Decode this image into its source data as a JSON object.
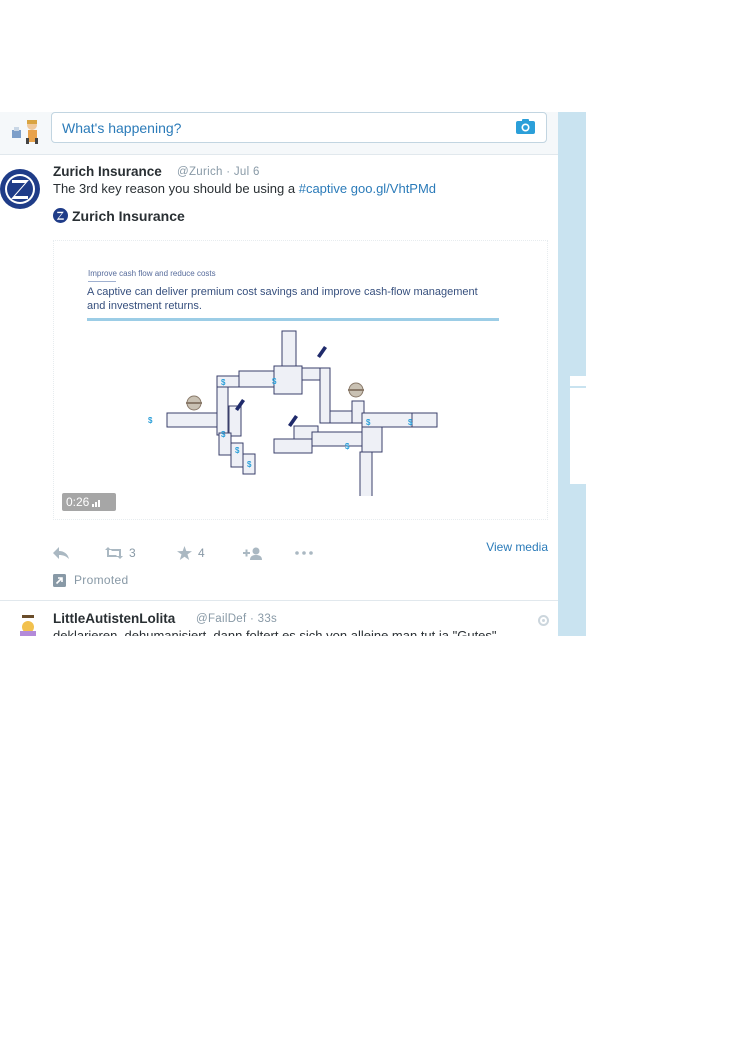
{
  "compose": {
    "placeholder": "What's happening?",
    "camera_icon": "camera-icon"
  },
  "tweet": {
    "author_name": "Zurich Insurance",
    "handle": "@Zurich",
    "date": "Jul 6",
    "text_before": "The 3rd key reason you should be using a ",
    "hashtag": "#captive",
    "url": "goo.gl/VhtPMd",
    "card_title": "Zurich Insurance",
    "media": {
      "kicker": "Improve cash flow and reduce costs",
      "headline": "A captive can deliver premium cost savings and improve cash-flow management and investment returns.",
      "duration": "0:26"
    },
    "actions": {
      "retweets": "3",
      "favorites": "4",
      "view_media": "View media"
    },
    "promoted": "Promoted"
  },
  "tweet2": {
    "author_name": "LittleAutistenLolita",
    "handle": "@FailDef",
    "age": "33s",
    "text": "deklarieren, dehumanisiert, dann foltert es sich von alleine man tut ja \"Gutes\""
  },
  "colors": {
    "link": "#2b7bb9",
    "brand_zurich": "#1f3c88",
    "sidebar": "#c9e3f0"
  }
}
